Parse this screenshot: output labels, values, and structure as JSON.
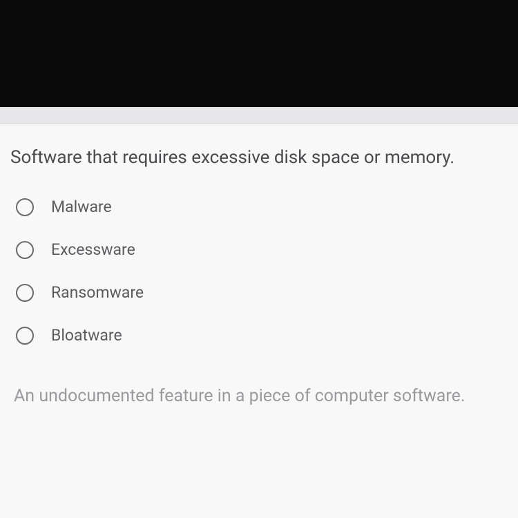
{
  "question": {
    "text": "Software that requires excessive disk space or memory.",
    "options": [
      {
        "label": "Malware"
      },
      {
        "label": "Excessware"
      },
      {
        "label": "Ransomware"
      },
      {
        "label": "Bloatware"
      }
    ]
  },
  "next_question": {
    "text": "An undocumented feature in a piece of computer software."
  }
}
